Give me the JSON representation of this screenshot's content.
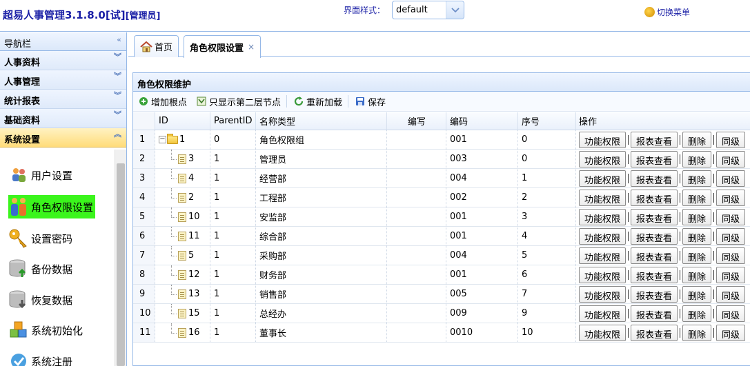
{
  "header": {
    "app_title": "超易人事管理3.1.8.0[试]",
    "role": "[管理员]",
    "style_label": "界面样式：",
    "style_value": "default",
    "switch_menu": "切换菜单"
  },
  "sidebar": {
    "title": "导航栏",
    "sections": [
      {
        "label": "人事资料"
      },
      {
        "label": "人事管理"
      },
      {
        "label": "统计报表"
      },
      {
        "label": "基础资料"
      },
      {
        "label": "系统设置"
      }
    ],
    "items": [
      {
        "label": "用户设置",
        "icon": "users-icon"
      },
      {
        "label": "角色权限设置",
        "icon": "role-icon"
      },
      {
        "label": "设置密码",
        "icon": "key-icon"
      },
      {
        "label": "备份数据",
        "icon": "database-backup-icon"
      },
      {
        "label": "恢复数据",
        "icon": "database-restore-icon"
      },
      {
        "label": "系统初始化",
        "icon": "cubes-icon"
      },
      {
        "label": "系统注册",
        "icon": "register-icon"
      }
    ]
  },
  "tabs": [
    {
      "label": "首页"
    },
    {
      "label": "角色权限设置",
      "close": "×"
    }
  ],
  "panel": {
    "title": "角色权限维护",
    "toolbar": {
      "add_root": "增加根点",
      "second_level": "只显示第二层节点",
      "reload": "重新加载",
      "save": "保存"
    }
  },
  "grid": {
    "headers": {
      "id": "ID",
      "parent_id": "ParentID",
      "name": "名称类型",
      "abbr": "编写",
      "code": "编码",
      "seq": "序号",
      "ops": "操作"
    },
    "ops": {
      "func": "功能权限",
      "report": "报表查看",
      "delete": "删除",
      "same": "同级"
    },
    "rows": [
      {
        "rn": "1",
        "id": "1",
        "pid": "0",
        "name": "角色权限组",
        "abbr": "",
        "code": "001",
        "seq": "0"
      },
      {
        "rn": "2",
        "id": "3",
        "pid": "1",
        "name": "管理员",
        "abbr": "",
        "code": "003",
        "seq": "0"
      },
      {
        "rn": "3",
        "id": "4",
        "pid": "1",
        "name": "经营部",
        "abbr": "",
        "code": "004",
        "seq": "1"
      },
      {
        "rn": "4",
        "id": "2",
        "pid": "1",
        "name": "工程部",
        "abbr": "",
        "code": "002",
        "seq": "2"
      },
      {
        "rn": "5",
        "id": "10",
        "pid": "1",
        "name": "安监部",
        "abbr": "",
        "code": "001",
        "seq": "3"
      },
      {
        "rn": "6",
        "id": "11",
        "pid": "1",
        "name": "综合部",
        "abbr": "",
        "code": "001",
        "seq": "4"
      },
      {
        "rn": "7",
        "id": "5",
        "pid": "1",
        "name": "采购部",
        "abbr": "",
        "code": "004",
        "seq": "5"
      },
      {
        "rn": "8",
        "id": "12",
        "pid": "1",
        "name": "财务部",
        "abbr": "",
        "code": "001",
        "seq": "6"
      },
      {
        "rn": "9",
        "id": "13",
        "pid": "1",
        "name": "销售部",
        "abbr": "",
        "code": "005",
        "seq": "7"
      },
      {
        "rn": "10",
        "id": "15",
        "pid": "1",
        "name": "总经办",
        "abbr": "",
        "code": "009",
        "seq": "9"
      },
      {
        "rn": "11",
        "id": "16",
        "pid": "1",
        "name": "董事长",
        "abbr": "",
        "code": "0010",
        "seq": "10"
      }
    ]
  }
}
